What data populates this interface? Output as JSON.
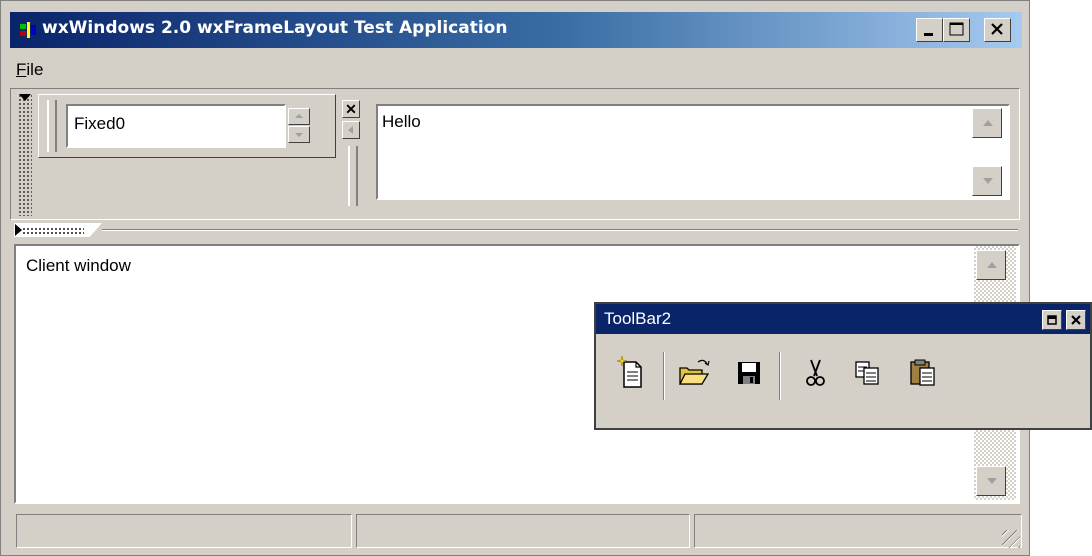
{
  "window": {
    "title": "wxWindows 2.0 wxFrameLayout Test Application"
  },
  "menu": {
    "file_label": "File",
    "file_mnemonic": "F",
    "file_rest": "ile"
  },
  "fixed_bar": {
    "value": "Fixed0"
  },
  "hello_bar": {
    "text": "Hello"
  },
  "client": {
    "text": "Client window"
  },
  "toolbar2": {
    "title": "ToolBar2",
    "buttons": [
      {
        "icon": "new-document-icon"
      },
      {
        "icon": "open-folder-icon"
      },
      {
        "icon": "save-icon"
      },
      {
        "icon": "cut-icon"
      },
      {
        "icon": "copy-icon"
      },
      {
        "icon": "paste-icon"
      }
    ]
  },
  "status_bar": {
    "fields": [
      "",
      "",
      ""
    ]
  },
  "colors": {
    "face": "#d4d0c8",
    "title_active_start": "#0a246a",
    "title_active_end": "#a6caf0"
  }
}
